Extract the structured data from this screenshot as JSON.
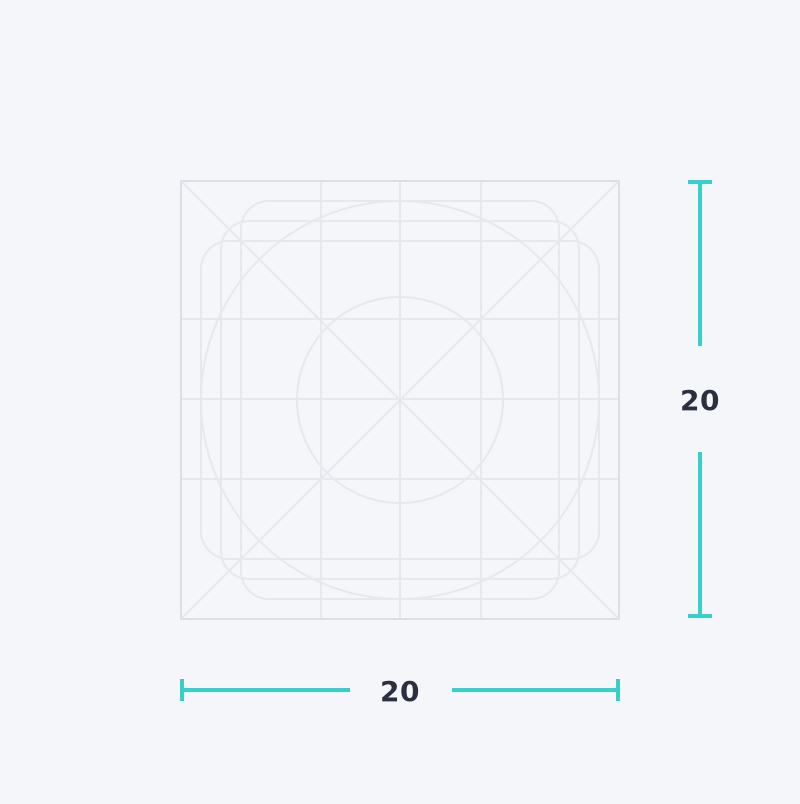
{
  "dimensions": {
    "width_value": "20",
    "height_value": "20"
  },
  "colors": {
    "background": "#f5f6fa",
    "grid_line": "#e6e8ee",
    "frame_border": "#dcdfe5",
    "measure_line": "#36cfc9",
    "label_text": "#2b2f3f"
  }
}
